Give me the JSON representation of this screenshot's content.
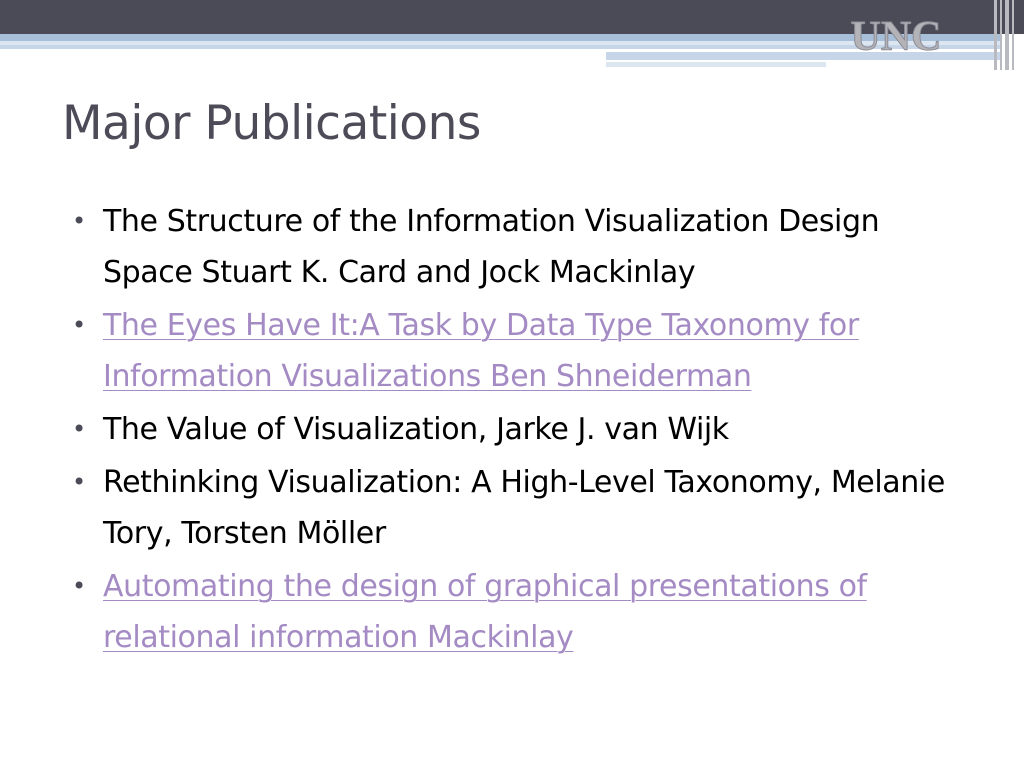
{
  "header": {
    "logo_text": "UNC",
    "colors": {
      "band": "#4a4b57",
      "stripe": "#a7bfd8",
      "accent": "#c6d6e8"
    }
  },
  "slide": {
    "title": "Major Publications",
    "bullet_glyph": "•",
    "items": [
      {
        "text": "The Structure of the Information Visualization Design Space Stuart K. Card and Jock Mackinlay",
        "is_link": false
      },
      {
        "text": "The Eyes Have It:A Task by Data Type Taxonomy for Information Visualizations Ben Shneiderman",
        "is_link": true
      },
      {
        "text": "The Value of Visualization, Jarke J. van Wijk",
        "is_link": false
      },
      {
        "text": "Rethinking Visualization: A High-Level Taxonomy, Melanie Tory, Torsten Möller",
        "is_link": false
      },
      {
        "text": "Automating the design of graphical presentations of relational information Mackinlay",
        "is_link": true
      }
    ],
    "colors": {
      "title": "#4c4b57",
      "text": "#000000",
      "link": "#a48bc4"
    }
  }
}
